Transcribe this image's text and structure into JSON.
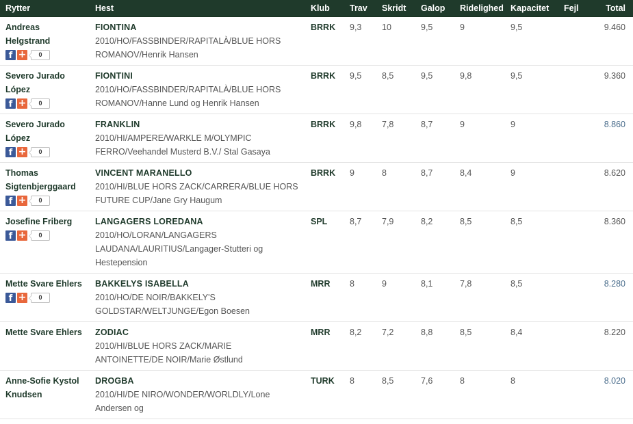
{
  "colors": {
    "header_bg": "#1f3a2b",
    "link_total": "#4a6d8c",
    "facebook": "#3b5998",
    "plus": "#e8673c"
  },
  "headers": {
    "rytter": "Rytter",
    "hest": "Hest",
    "klub": "Klub",
    "trav": "Trav",
    "skridt": "Skridt",
    "galop": "Galop",
    "ridelighed": "Ridelighed",
    "kapacitet": "Kapacitet",
    "fejl": "Fejl",
    "total": "Total"
  },
  "rows": [
    {
      "rider": "Andreas Helgstrand",
      "horse": "FIONTINA",
      "desc": "2010/HO/FASSBINDER/RAPITALÀ/BLUE HORS ROMANOV/Henrik Hansen",
      "club": "BRRK",
      "trav": "9,3",
      "skridt": "10",
      "galop": "9,5",
      "ridelighed": "9",
      "kapacitet": "9,5",
      "fejl": "",
      "total": "9.460",
      "total_link": false,
      "share": true,
      "share_count": "0"
    },
    {
      "rider": "Severo Jurado López",
      "horse": "FIONTINI",
      "desc": "2010/HO/FASSBINDER/RAPITALÀ/BLUE HORS ROMANOV/Hanne Lund og Henrik Hansen",
      "club": "BRRK",
      "trav": "9,5",
      "skridt": "8,5",
      "galop": "9,5",
      "ridelighed": "9,8",
      "kapacitet": "9,5",
      "fejl": "",
      "total": "9.360",
      "total_link": false,
      "share": true,
      "share_count": "0"
    },
    {
      "rider": "Severo Jurado López",
      "horse": "FRANKLIN",
      "desc": "2010/HI/AMPERE/WARKLE M/OLYMPIC FERRO/Veehandel Musterd B.V./ Stal Gasaya",
      "club": "BRRK",
      "trav": "9,8",
      "skridt": "7,8",
      "galop": "8,7",
      "ridelighed": "9",
      "kapacitet": "9",
      "fejl": "",
      "total": "8.860",
      "total_link": true,
      "share": true,
      "share_count": "0"
    },
    {
      "rider": "Thomas Sigtenbjerggaard",
      "horse": "VINCENT MARANELLO",
      "desc": "2010/HI/BLUE HORS ZACK/CARRERA/BLUE HORS FUTURE CUP/Jane Gry Haugum",
      "club": "BRRK",
      "trav": "9",
      "skridt": "8",
      "galop": "8,7",
      "ridelighed": "8,4",
      "kapacitet": "9",
      "fejl": "",
      "total": "8.620",
      "total_link": false,
      "share": true,
      "share_count": "0"
    },
    {
      "rider": "Josefine Friberg",
      "horse": "LANGAGERS LOREDANA",
      "desc": "2010/HO/LORAN/LANGAGERS LAUDANA/LAURITIUS/Langager-Stutteri og Hestepension",
      "club": "SPL",
      "trav": "8,7",
      "skridt": "7,9",
      "galop": "8,2",
      "ridelighed": "8,5",
      "kapacitet": "8,5",
      "fejl": "",
      "total": "8.360",
      "total_link": false,
      "share": true,
      "share_count": "0"
    },
    {
      "rider": "Mette Svare Ehlers",
      "horse": "BAKKELYS ISABELLA",
      "desc": "2010/HO/DE NOIR/BAKKELY'S GOLDSTAR/WELTJUNGE/Egon Boesen",
      "club": "MRR",
      "trav": "8",
      "skridt": "9",
      "galop": "8,1",
      "ridelighed": "7,8",
      "kapacitet": "8,5",
      "fejl": "",
      "total": "8.280",
      "total_link": true,
      "share": true,
      "share_count": "0"
    },
    {
      "rider": "Mette Svare Ehlers",
      "horse": "ZODIAC",
      "desc": "2010/HI/BLUE HORS ZACK/MARIE ANTOINETTE/DE NOIR/Marie Østlund",
      "club": "MRR",
      "trav": "8,2",
      "skridt": "7,2",
      "galop": "8,8",
      "ridelighed": "8,5",
      "kapacitet": "8,4",
      "fejl": "",
      "total": "8.220",
      "total_link": false,
      "share": false,
      "share_count": ""
    },
    {
      "rider": "Anne-Sofie Kystol Knudsen",
      "horse": "DROGBA",
      "desc": "2010/HI/DE NIRO/WONDER/WORLDLY/Lone Andersen og",
      "club": "TURK",
      "trav": "8",
      "skridt": "8,5",
      "galop": "7,6",
      "ridelighed": "8",
      "kapacitet": "8",
      "fejl": "",
      "total": "8.020",
      "total_link": true,
      "share": false,
      "share_count": ""
    }
  ]
}
